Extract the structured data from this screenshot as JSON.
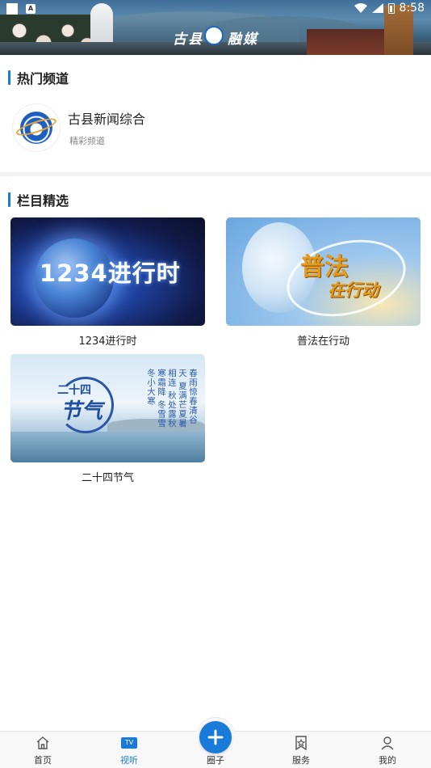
{
  "status_bar": {
    "time": "8:58",
    "notif_badge": "A"
  },
  "banner": {
    "logo_left": "古县",
    "logo_right": "融媒"
  },
  "hot_channels": {
    "title": "热门频道",
    "items": [
      {
        "name": "古县新闻综合",
        "subtitle": "精彩频道"
      }
    ]
  },
  "programs": {
    "title": "栏目精选",
    "items": [
      {
        "label": "1234进行时",
        "thumb_text": "1234进行时"
      },
      {
        "label": "普法在行动",
        "thumb_text_1": "普法",
        "thumb_text_2": "在行动"
      },
      {
        "label": "二十四节气",
        "thumb_top": "二十四",
        "thumb_main": "节气",
        "thumb_poem": "春雨惊春清谷天 夏满芒夏暑相连 秋处露秋寒霜降 冬雪雪冬小大寒"
      }
    ]
  },
  "tabbar": {
    "items": [
      {
        "label": "首页"
      },
      {
        "label": "视听",
        "icon_text": "TV"
      },
      {
        "label": "圈子"
      },
      {
        "label": "服务"
      },
      {
        "label": "我的"
      }
    ]
  },
  "colors": {
    "accent": "#1a7ad9",
    "divider": "#f2f2f2"
  }
}
